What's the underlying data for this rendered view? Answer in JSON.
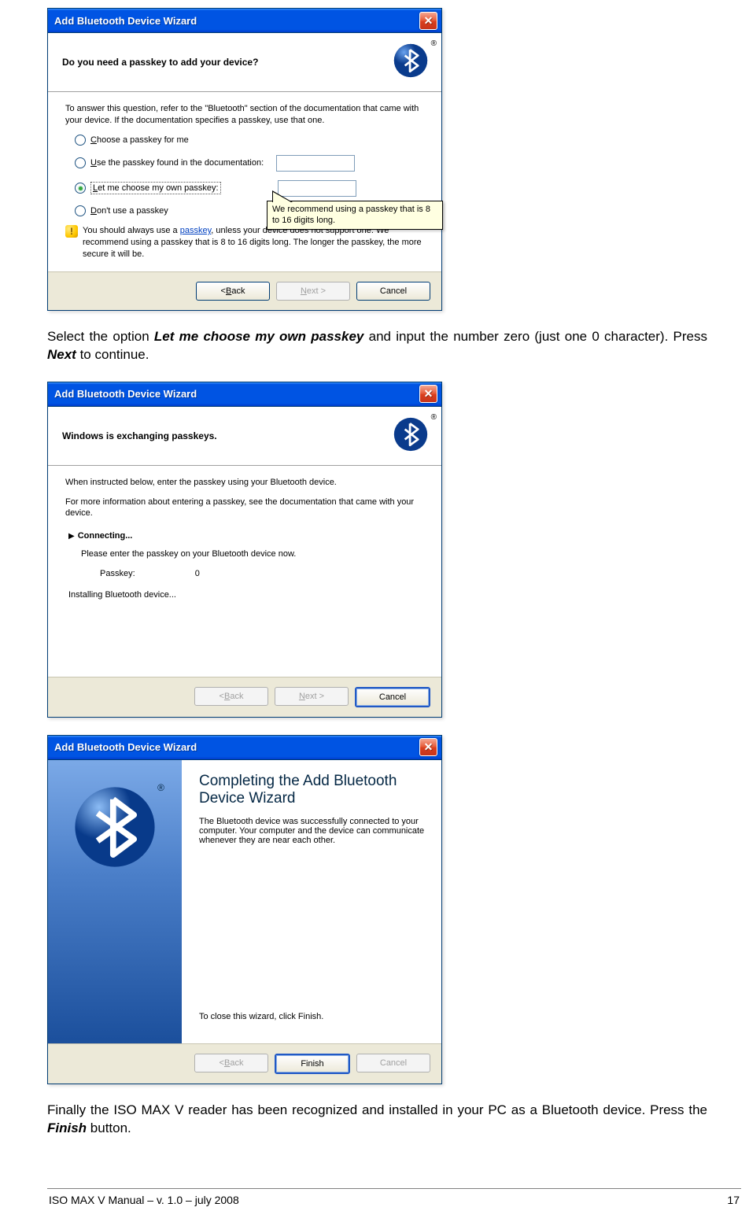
{
  "dialog1": {
    "title": "Add Bluetooth Device Wizard",
    "header": "Do you need a passkey to add your device?",
    "intro": "To answer this question, refer to the \"Bluetooth\" section of the documentation that came with your device. If the documentation specifies a passkey, use that one.",
    "opt_choose": "Choose a passkey for me",
    "opt_doc": "Use the passkey found in the documentation:",
    "opt_own": "Let me choose my own passkey:",
    "opt_none": "Don't use a passkey",
    "tooltip": "We recommend using a passkey that is 8 to 16 digits long.",
    "info": "You should always use a passkey, unless your device does not support one. We recommend using a passkey that is 8 to 16 digits long. The longer the passkey, the more secure it will be.",
    "info_link": "passkey",
    "back": "< Back",
    "next": "Next >",
    "cancel": "Cancel"
  },
  "para1_a": "Select the option ",
  "para1_b": "Let me choose my own passkey",
  "para1_c": " and input the number zero (just one 0 character). Press ",
  "para1_d": "Next",
  "para1_e": " to continue.",
  "dialog2": {
    "title": "Add Bluetooth Device Wizard",
    "header": "Windows is exchanging passkeys.",
    "line1": "When instructed below, enter the passkey using your Bluetooth device.",
    "line2": "For more information about entering a passkey, see the documentation that came with your device.",
    "connecting": "Connecting...",
    "instr": "Please enter the passkey on your Bluetooth device now.",
    "passkey_label": "Passkey:",
    "passkey_value": "0",
    "installing": "Installing Bluetooth device...",
    "back": "< Back",
    "next": "Next >",
    "cancel": "Cancel"
  },
  "dialog3": {
    "title": "Add Bluetooth Device Wizard",
    "heading": "Completing the Add Bluetooth Device Wizard",
    "body": "The Bluetooth device was successfully connected to your computer. Your computer and the device can communicate whenever they are near each other.",
    "close": "To close this wizard, click Finish.",
    "back": "< Back",
    "finish": "Finish",
    "cancel": "Cancel"
  },
  "para2_a": "Finally the ISO MAX V reader has been recognized and installed in your PC as a Bluetooth device. Press the ",
  "para2_b": "Finish",
  "para2_c": " button.",
  "footer_left": "ISO MAX V Manual – v. 1.0 – july 2008",
  "footer_right": "17"
}
